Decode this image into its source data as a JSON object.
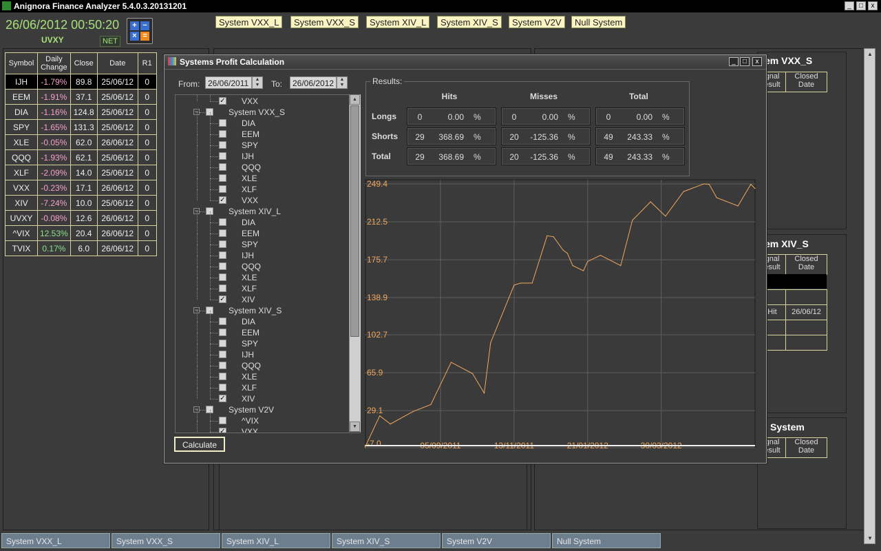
{
  "app": {
    "title": "Anignora Finance Analyzer  5.4.0.3.20131201",
    "clock": "26/06/2012 00:50:20",
    "symbol": "UVXY",
    "net_badge": "NET"
  },
  "system_buttons": [
    "System VXX_L",
    "System VXX_S",
    "System XIV_L",
    "System XIV_S",
    "System V2V",
    "Null System"
  ],
  "quotes": {
    "headers": [
      "Symbol",
      "Daily Change",
      "Close",
      "Date",
      "R1"
    ],
    "rows": [
      [
        "IJH",
        "-1.79%",
        "89.8",
        "25/06/12",
        "0"
      ],
      [
        "EEM",
        "-1.91%",
        "37.1",
        "25/06/12",
        "0"
      ],
      [
        "DIA",
        "-1.16%",
        "124.8",
        "25/06/12",
        "0"
      ],
      [
        "SPY",
        "-1.65%",
        "131.3",
        "25/06/12",
        "0"
      ],
      [
        "XLE",
        "-0.05%",
        "62.0",
        "26/06/12",
        "0"
      ],
      [
        "QQQ",
        "-1.93%",
        "62.1",
        "25/06/12",
        "0"
      ],
      [
        "XLF",
        "-2.09%",
        "14.0",
        "25/06/12",
        "0"
      ],
      [
        "VXX",
        "-0.23%",
        "17.1",
        "26/06/12",
        "0"
      ],
      [
        "XIV",
        "-7.24%",
        "10.0",
        "25/06/12",
        "0"
      ],
      [
        "UVXY",
        "-0.08%",
        "12.6",
        "26/06/12",
        "0"
      ],
      [
        "^VIX",
        "12.53%",
        "20.4",
        "26/06/12",
        "0"
      ],
      [
        "TVIX",
        "0.17%",
        "6.0",
        "26/06/12",
        "0"
      ]
    ]
  },
  "right_panels": {
    "titles": [
      "em VXX_S",
      "em XIV_S",
      "System"
    ],
    "col_signal": "gnal\nesult",
    "col_closed": "Closed\nDate",
    "xiv_row_result": "Hit",
    "xiv_row_date": "26/06/12"
  },
  "dialog": {
    "title": "Systems Profit Calculation",
    "from_label": "From:",
    "from_value": "26/06/2011",
    "to_label": "To:",
    "to_value": "26/06/2012",
    "calculate": "Calculate",
    "results_label": "Results:",
    "col_headers": [
      "Hits",
      "Misses",
      "Total"
    ],
    "row_labels": [
      "Longs",
      "Shorts",
      "Total"
    ],
    "unit": "%",
    "results": [
      [
        [
          "0",
          "0.00"
        ],
        [
          "0",
          "0.00"
        ],
        [
          "0",
          "0.00"
        ]
      ],
      [
        [
          "29",
          "368.69"
        ],
        [
          "20",
          "-125.36"
        ],
        [
          "49",
          "243.33"
        ]
      ],
      [
        [
          "29",
          "368.69"
        ],
        [
          "20",
          "-125.36"
        ],
        [
          "49",
          "243.33"
        ]
      ]
    ],
    "tree": [
      {
        "type": "leaf",
        "label": "VXX",
        "checked": true
      },
      {
        "type": "group",
        "label": "System VXX_S"
      },
      {
        "type": "leaf",
        "label": "DIA",
        "checked": false
      },
      {
        "type": "leaf",
        "label": "EEM",
        "checked": false
      },
      {
        "type": "leaf",
        "label": "SPY",
        "checked": false
      },
      {
        "type": "leaf",
        "label": "IJH",
        "checked": false
      },
      {
        "type": "leaf",
        "label": "QQQ",
        "checked": false
      },
      {
        "type": "leaf",
        "label": "XLE",
        "checked": false
      },
      {
        "type": "leaf",
        "label": "XLF",
        "checked": false
      },
      {
        "type": "leaf",
        "label": "VXX",
        "checked": true
      },
      {
        "type": "group",
        "label": "System XIV_L"
      },
      {
        "type": "leaf",
        "label": "DIA",
        "checked": false
      },
      {
        "type": "leaf",
        "label": "EEM",
        "checked": false
      },
      {
        "type": "leaf",
        "label": "SPY",
        "checked": false
      },
      {
        "type": "leaf",
        "label": "IJH",
        "checked": false
      },
      {
        "type": "leaf",
        "label": "QQQ",
        "checked": false
      },
      {
        "type": "leaf",
        "label": "XLE",
        "checked": false
      },
      {
        "type": "leaf",
        "label": "XLF",
        "checked": false
      },
      {
        "type": "leaf",
        "label": "XIV",
        "checked": true
      },
      {
        "type": "group",
        "label": "System XIV_S"
      },
      {
        "type": "leaf",
        "label": "DIA",
        "checked": false
      },
      {
        "type": "leaf",
        "label": "EEM",
        "checked": false
      },
      {
        "type": "leaf",
        "label": "SPY",
        "checked": false
      },
      {
        "type": "leaf",
        "label": "IJH",
        "checked": false
      },
      {
        "type": "leaf",
        "label": "QQQ",
        "checked": false
      },
      {
        "type": "leaf",
        "label": "XLE",
        "checked": false
      },
      {
        "type": "leaf",
        "label": "XLF",
        "checked": false
      },
      {
        "type": "leaf",
        "label": "XIV",
        "checked": true
      },
      {
        "type": "group",
        "label": "System V2V"
      },
      {
        "type": "leaf",
        "label": "^VIX",
        "checked": false
      },
      {
        "type": "leaf",
        "label": "VXX",
        "checked": true
      }
    ]
  },
  "bottom_tabs": [
    "System VXX_L",
    "System VXX_S",
    "System XIV_L",
    "System XIV_S",
    "System V2V",
    "Null System"
  ],
  "colors": {
    "line": "#f0a860",
    "tick": "#f0a860",
    "positive": "#8be08b",
    "negative": "#f6a0c8",
    "accent_button": "#fbf4c3"
  },
  "chart_data": {
    "type": "line",
    "title": "",
    "xlabel": "",
    "ylabel": "",
    "ylim": [
      -7.0,
      249.4
    ],
    "y_ticks": [
      "249.4",
      "212.5",
      "175.7",
      "138.9",
      "102.7",
      "65.9",
      "29.1",
      "-7.0"
    ],
    "x_ticks": [
      {
        "label": "05/09/2011",
        "x": "2011-09-05"
      },
      {
        "label": "13/11/2011",
        "x": "2011-11-13"
      },
      {
        "label": "21/01/2012",
        "x": "2012-01-21"
      },
      {
        "label": "30/03/2012",
        "x": "2012-03-30"
      }
    ],
    "xlim": [
      "2011-06-26",
      "2012-06-26"
    ],
    "grid": true,
    "series": [
      {
        "x": [
          "2011-06-26",
          "2011-07-10",
          "2011-07-20",
          "2011-08-10",
          "2011-08-27",
          "2011-09-15",
          "2011-10-05",
          "2011-10-16",
          "2011-10-22",
          "2011-11-13",
          "2011-11-19",
          "2011-11-30",
          "2011-12-14",
          "2011-12-20",
          "2011-12-29",
          "2012-01-02",
          "2012-01-07",
          "2012-01-17",
          "2012-01-21",
          "2012-02-02",
          "2012-02-21",
          "2012-03-03",
          "2012-03-20",
          "2012-04-03",
          "2012-04-20",
          "2012-05-09",
          "2012-05-14",
          "2012-05-21",
          "2012-06-10",
          "2012-06-22",
          "2012-06-26"
        ],
        "y": [
          -7.0,
          24.0,
          16.0,
          28.0,
          35.0,
          76.0,
          65.0,
          46.0,
          95.0,
          151.0,
          153.0,
          153.0,
          199.0,
          198.0,
          185.0,
          182.0,
          170.0,
          165.0,
          174.0,
          180.0,
          170.0,
          214.0,
          232.0,
          218.0,
          242.0,
          254.0,
          249.0,
          236.0,
          228.0,
          249.0,
          245.0
        ]
      }
    ]
  }
}
